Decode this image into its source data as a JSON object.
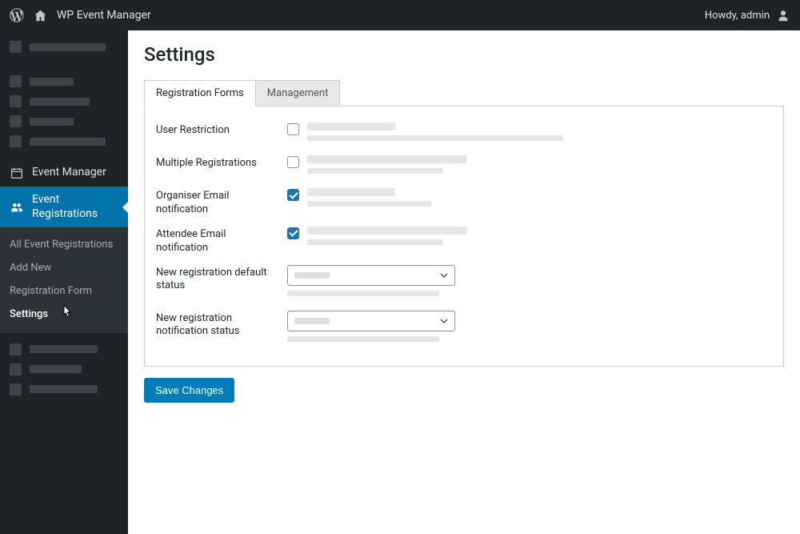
{
  "topbar": {
    "site_title": "WP Event Manager",
    "greeting": "Howdy, admin"
  },
  "sidebar": {
    "event_manager_label": "Event Manager",
    "event_registrations_label": "Event Registrations",
    "submenu": {
      "all": "All Event Registrations",
      "add": "Add New",
      "form": "Registration Form",
      "settings": "Settings"
    }
  },
  "page": {
    "title": "Settings",
    "tabs": {
      "forms": "Registration Forms",
      "management": "Management"
    },
    "fields": {
      "user_restriction": "User Restriction",
      "multiple_registrations": "Multiple Registrations",
      "organiser_email": "Organiser Email notification",
      "attendee_email": "Attendee Email notification",
      "default_status": "New registration default status",
      "notification_status": "New registration notification status"
    },
    "save_label": "Save Changes"
  },
  "state": {
    "user_restriction_checked": false,
    "multiple_registrations_checked": false,
    "organiser_email_checked": true,
    "attendee_email_checked": true
  }
}
